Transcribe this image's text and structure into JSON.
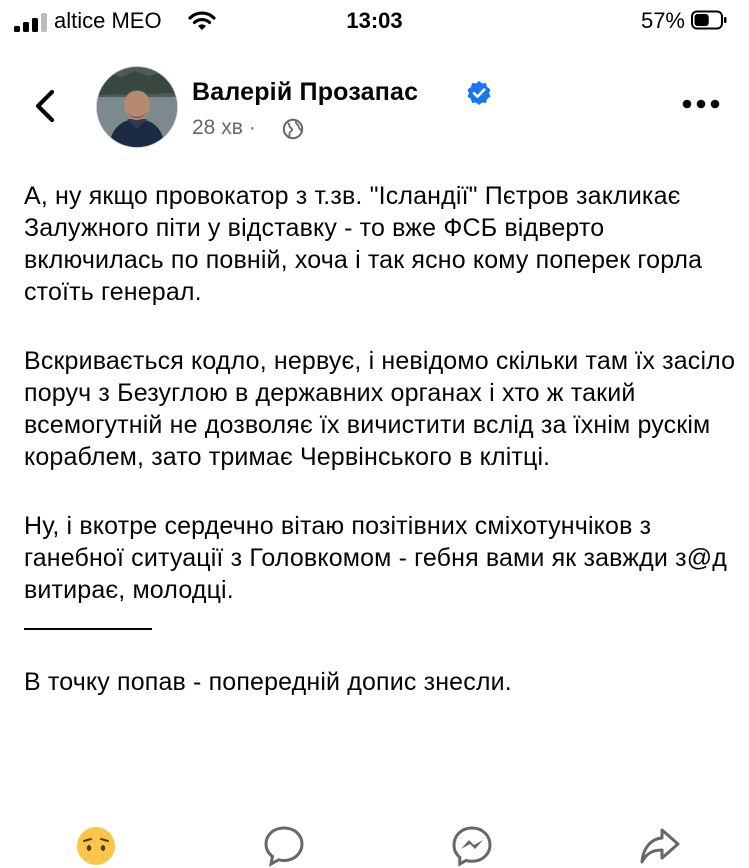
{
  "status_bar": {
    "carrier": "altice MEO",
    "time": "13:03",
    "battery_percent": "57%",
    "battery_level": 0.57,
    "signal_bars": 3
  },
  "header": {
    "author_name": "Валерій Прозапас",
    "verified": true,
    "post_age": "28 хв",
    "separator": "·",
    "audience_icon": "globe-icon"
  },
  "post": {
    "paragraphs": [
      "А, ну якщо провокатор з т.зв.  \"Ісландії\" Пєтров закликає  Залужного піти у відставку - то вже ФСБ відверто включилась по повній, хоча і так ясно кому поперек горла стоїть генерал.",
      "Вскривається кодло, нервує, і невідомо скільки там їх засіло поруч з Безуглою в державних органах і хто ж такий всемогутній не дозволяє їх вичистити вслід за їхнім рускім кораблем, зато тримає Червінського в клітці.",
      "Ну, і вкотре сердечно вітаю позітівних сміхотунчіков з ганебної ситуації з Головкомом - гебня вами як завжди з@д витирає, молодці."
    ],
    "after_divider": "В точку попав -  попередній допис знесли."
  },
  "actions": {
    "reaction_icon": "sad-reaction-icon",
    "comment_icon": "comment-icon",
    "messenger_icon": "messenger-icon",
    "share_icon": "share-icon"
  },
  "colors": {
    "text": "#050505",
    "secondary_text": "#65676b",
    "verified_blue": "#1877f2"
  }
}
